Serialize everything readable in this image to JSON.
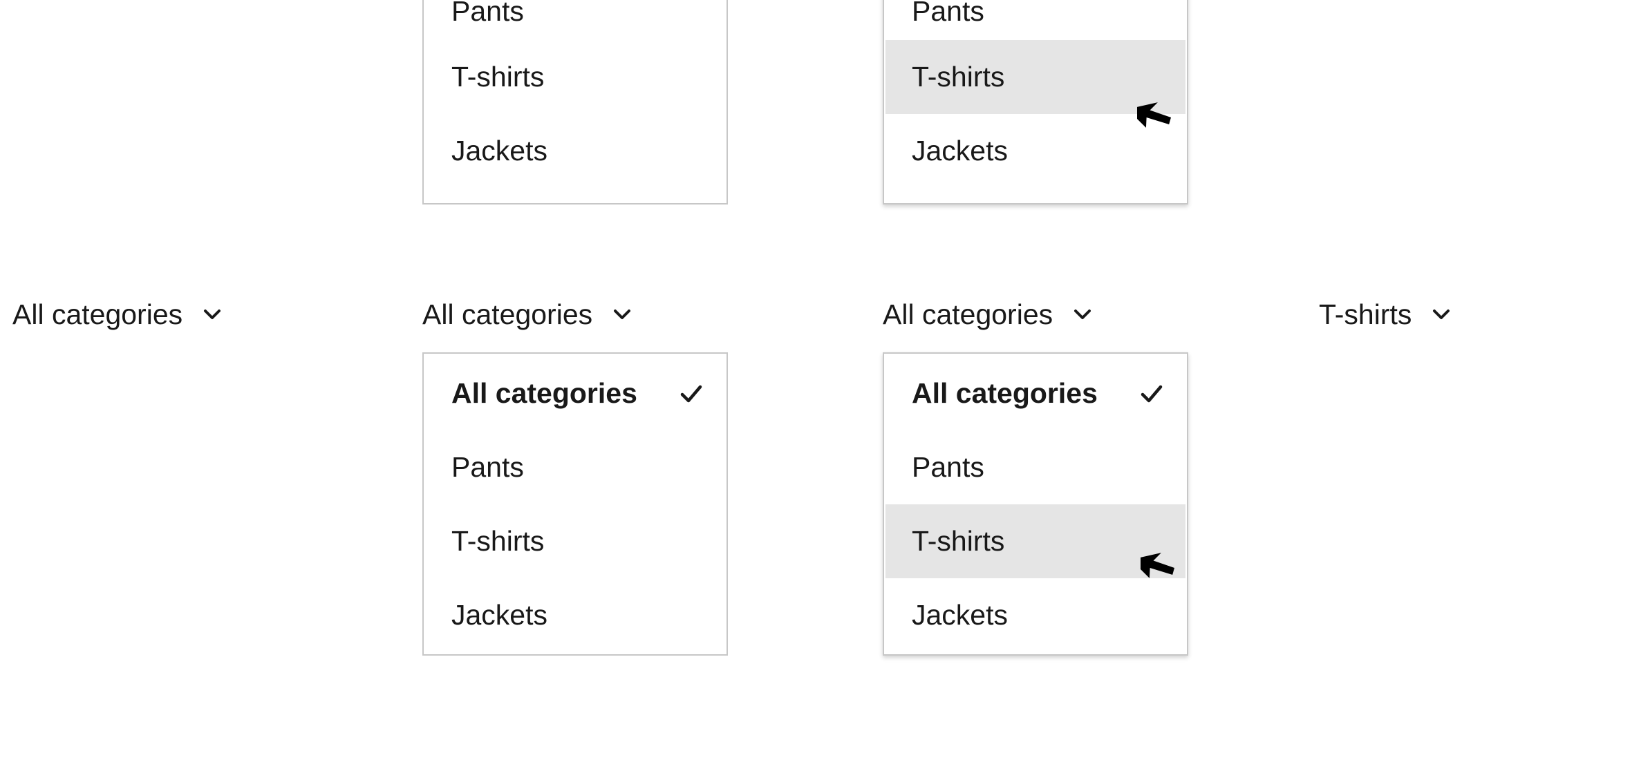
{
  "colors": {
    "text": "#191919",
    "border": "#c7c7c7",
    "hover_bg": "#e5e5e5",
    "background": "#ffffff"
  },
  "icons": {
    "chevron": "chevron-down-icon",
    "check": "checkmark-icon",
    "cursor": "mouse-pointer-icon"
  },
  "top_menus": [
    {
      "items": [
        "Pants",
        "T-shirts",
        "Jackets"
      ],
      "hovered": ""
    },
    {
      "items": [
        "Pants",
        "T-shirts",
        "Jackets"
      ],
      "hovered": "T-shirts"
    }
  ],
  "dropdowns": [
    {
      "trigger_label": "All categories",
      "expanded": false
    },
    {
      "trigger_label": "All categories",
      "expanded": true,
      "options": [
        "All categories",
        "Pants",
        "T-shirts",
        "Jackets"
      ],
      "selected": "All categories",
      "hovered": ""
    },
    {
      "trigger_label": "All categories",
      "expanded": true,
      "options": [
        "All categories",
        "Pants",
        "T-shirts",
        "Jackets"
      ],
      "selected": "All categories",
      "hovered": "T-shirts"
    },
    {
      "trigger_label": "T-shirts",
      "expanded": false
    }
  ]
}
